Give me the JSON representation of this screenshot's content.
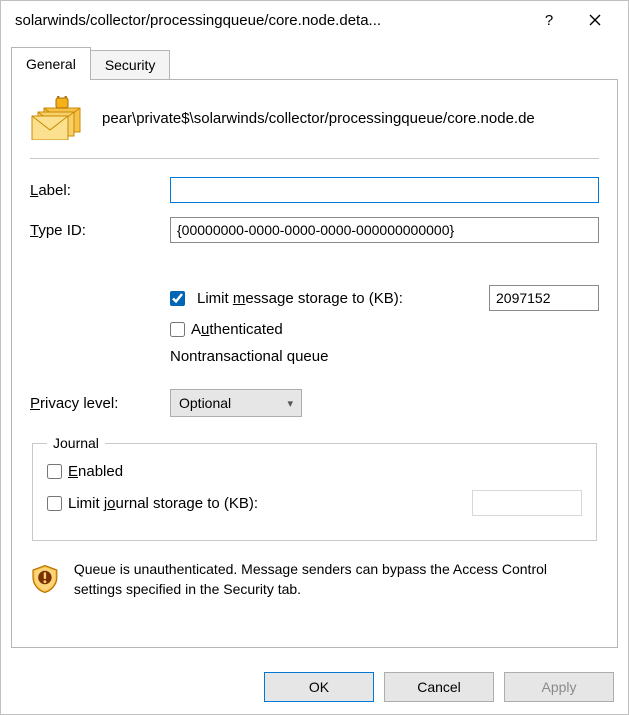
{
  "window": {
    "title": "solarwinds/collector/processingqueue/core.node.deta...",
    "help": "?"
  },
  "tabs": {
    "general": "General",
    "security": "Security"
  },
  "general": {
    "path": "pear\\private$\\solarwinds/collector/processingqueue/core.node.de",
    "label_label": "Label:",
    "label_accesskey": "L",
    "label_value": "",
    "typeid_label": "Type ID:",
    "typeid_accesskey": "T",
    "typeid_value": "{00000000-0000-0000-0000-000000000000}",
    "limit": {
      "checked": true,
      "label": "Limit message storage to (KB):",
      "accesskey": "m",
      "value": "2097152"
    },
    "auth": {
      "checked": false,
      "label": "Authenticated",
      "accesskey": "u"
    },
    "nontransactional": "Nontransactional queue",
    "privacy": {
      "label": "Privacy level:",
      "accesskey": "P",
      "value": "Optional"
    },
    "journal": {
      "legend": "Journal",
      "enabled_label": "Enabled",
      "enabled_accesskey": "E",
      "enabled_checked": false,
      "limit_label": "Limit journal storage to (KB):",
      "limit_accesskey": "o",
      "limit_checked": false,
      "limit_value": ""
    },
    "warning": "Queue is unauthenticated. Message senders can bypass the Access Control settings specified in the Security tab."
  },
  "buttons": {
    "ok": "OK",
    "cancel": "Cancel",
    "apply": "Apply"
  },
  "colors": {
    "accent": "#0078d7",
    "warn_shield": "#f5a623",
    "warn_shield_border": "#c06a00"
  }
}
